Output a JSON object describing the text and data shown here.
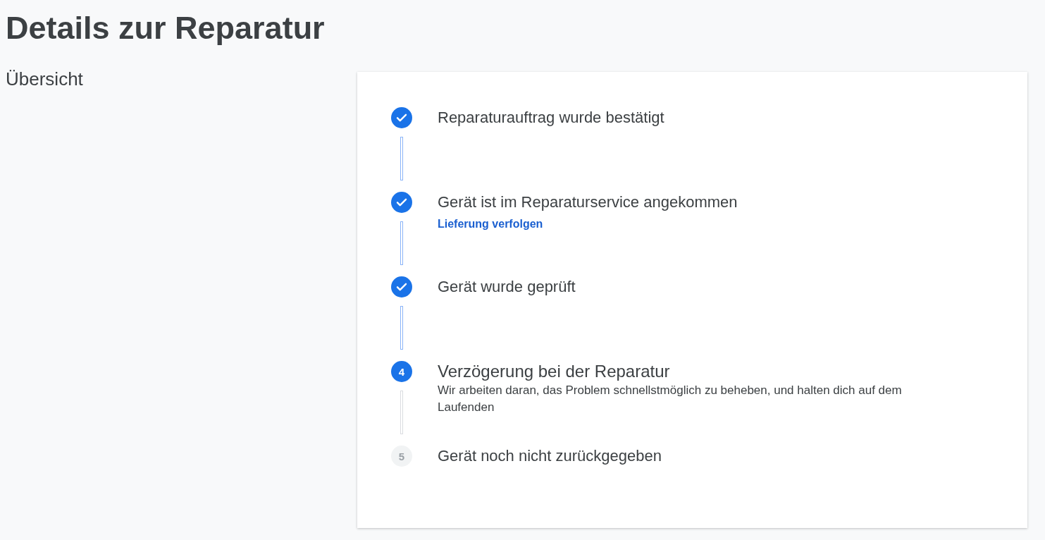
{
  "page_title": "Details zur Reparatur",
  "section_label": "Übersicht",
  "steps": [
    {
      "kind": "done",
      "title": "Reparaturauftrag wurde bestätigt"
    },
    {
      "kind": "done",
      "title": "Gerät ist im Reparaturservice angekommen",
      "link": "Lieferung verfolgen"
    },
    {
      "kind": "done",
      "title": "Gerät wurde geprüft"
    },
    {
      "kind": "current",
      "number": "4",
      "title": "Verzögerung bei der Reparatur",
      "description": "Wir arbeiten daran, das Problem schnellstmöglich zu beheben, und halten dich auf dem Laufenden"
    },
    {
      "kind": "pending",
      "number": "5",
      "title": "Gerät noch nicht zurückgegeben"
    }
  ]
}
